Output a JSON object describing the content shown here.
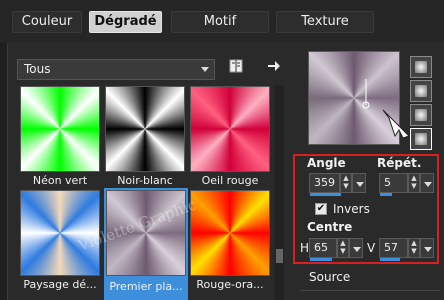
{
  "tabs": [
    {
      "label": "Couleur",
      "active": false
    },
    {
      "label": "Dégradé",
      "active": true
    },
    {
      "label": "Motif",
      "active": false
    },
    {
      "label": "Texture",
      "active": false
    }
  ],
  "library": {
    "selected": "Tous"
  },
  "gradients": [
    {
      "label": "Néon vert",
      "selected": false
    },
    {
      "label": "Noir-blanc",
      "selected": false
    },
    {
      "label": "Oeil rouge",
      "selected": false
    },
    {
      "label": "Paysage dé...",
      "selected": false
    },
    {
      "label": "Premier pla...",
      "selected": true
    },
    {
      "label": "Rouge-ora...",
      "selected": false
    }
  ],
  "settings": {
    "angle_label": "Angle",
    "angle_value": "359",
    "repeat_label": "Répét.",
    "repeat_value": "5",
    "invert_label": "Invers",
    "invert_checked": true,
    "center_label": "Centre",
    "h_label": "H",
    "h_value": "65",
    "v_label": "V",
    "v_value": "57",
    "source_label": "Source"
  },
  "watermark": "Violette Graphic",
  "icons": {
    "book": "book-icon",
    "arrow": "arrow-right-icon"
  }
}
